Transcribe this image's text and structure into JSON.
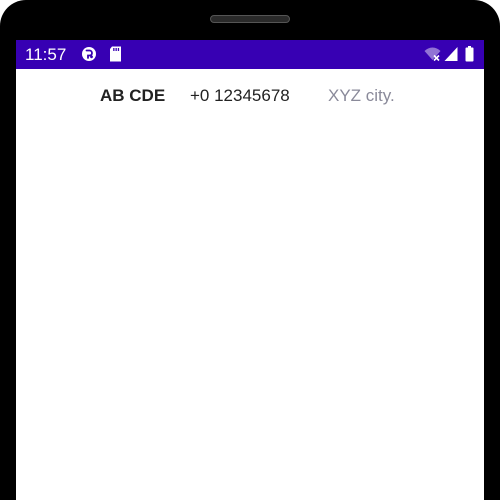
{
  "status_bar": {
    "time": "11:57",
    "background_color": "#3700b3",
    "left_icons": [
      "app-notification-icon",
      "sd-card-icon"
    ],
    "right_icons": [
      "wifi-off-icon",
      "cell-signal-icon",
      "battery-icon"
    ]
  },
  "contact": {
    "name": "AB CDE",
    "phone": "+0 12345678",
    "city": "XYZ city."
  }
}
